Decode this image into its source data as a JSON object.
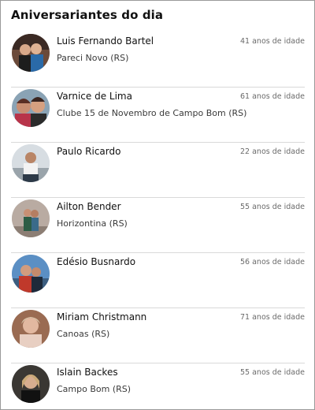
{
  "widget": {
    "title": "Aniversariantes do dia"
  },
  "birthdays": [
    {
      "name": "Luis Fernando Bartel",
      "location": "Pareci Novo (RS)",
      "age": "41 anos de idade",
      "avatar_icon": "person-photo"
    },
    {
      "name": "Varnice de Lima",
      "location": "Clube 15 de Novembro  de Campo Bom (RS)",
      "age": "61 anos de idade",
      "avatar_icon": "person-photo"
    },
    {
      "name": "Paulo Ricardo",
      "location": "",
      "age": "22 anos de idade",
      "avatar_icon": "person-photo"
    },
    {
      "name": "Ailton Bender",
      "location": "Horizontina (RS)",
      "age": "55 anos de idade",
      "avatar_icon": "person-photo"
    },
    {
      "name": "Edésio Busnardo",
      "location": "",
      "age": "56 anos de idade",
      "avatar_icon": "person-photo"
    },
    {
      "name": "Miriam Christmann",
      "location": "Canoas (RS)",
      "age": "71 anos de idade",
      "avatar_icon": "person-photo"
    },
    {
      "name": "Islain Backes",
      "location": "Campo Bom (RS)",
      "age": "55 anos de idade",
      "avatar_icon": "person-photo"
    }
  ]
}
